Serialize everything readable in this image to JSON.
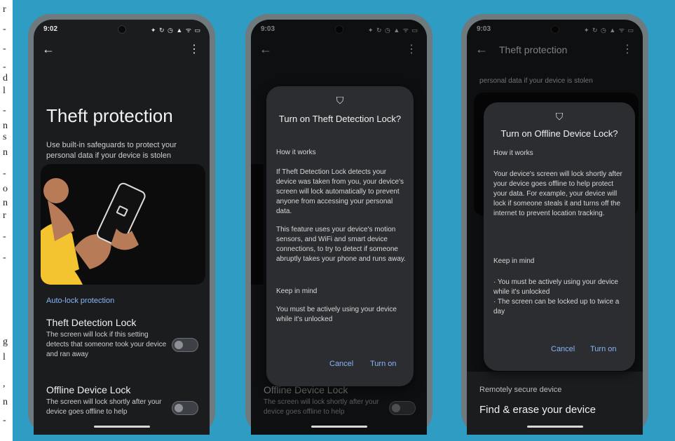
{
  "left_fragments": [
    "r",
    "-",
    "-",
    "-",
    "d",
    "l",
    "-",
    "n",
    "s",
    "n",
    "-",
    "o",
    "n",
    "r",
    "-",
    "-",
    "g",
    "l",
    ",",
    "n",
    "-"
  ],
  "phone1": {
    "time": "9:02",
    "status_icons": "✦ ↻ ◷ ▲ ᯤ ▭",
    "title": "Theft protection",
    "subtitle": "Use built-in safeguards to protect your personal data if your device is stolen",
    "section": "Auto-lock protection",
    "item1_title": "Theft Detection Lock",
    "item1_desc": "The screen will lock if this setting detects that someone took your device and ran away",
    "item2_title": "Offline Device Lock",
    "item2_desc": "The screen will lock shortly after your device goes offline to help"
  },
  "phone2": {
    "time": "9:03",
    "status_icons": "✦ ↻ ◷ ▲ ᯤ ▭",
    "dialog_title": "Turn on Theft Detection Lock?",
    "how": "How it works",
    "p1": "If Theft Detection Lock detects your device was taken from you, your device's screen will lock automatically to prevent anyone from accessing your personal data.",
    "p2": "This feature uses your device's motion sensors, and WiFi and smart device connections, to try to detect if someone abruptly takes your phone and runs away.",
    "keep": "Keep in mind",
    "p3": "You must be actively using your device while it's unlocked",
    "cancel": "Cancel",
    "turn_on": "Turn on",
    "bg_item_title": "Offline Device Lock",
    "bg_item_desc": "The screen will lock shortly after your device goes offline to help"
  },
  "phone3": {
    "time": "9:03",
    "status_icons": "✦ ↻ ◷ ▲ ᯤ ▭",
    "bar_title": "Theft protection",
    "bg_subtitle": "personal data if your device is stolen",
    "dialog_title": "Turn on Offline Device Lock?",
    "how": "How it works",
    "p1": "Your device's screen will lock shortly after your device goes offline to help protect your data. For example, your device will lock if someone steals it and turns off the internet to prevent location tracking.",
    "keep": "Keep in mind",
    "b1": "· You must be actively using your device while it's unlocked",
    "b2": "· The screen can be locked up to twice a day",
    "cancel": "Cancel",
    "turn_on": "Turn on",
    "bg_section": "Remotely secure device",
    "bg_item_title": "Find & erase your device"
  },
  "colors": {
    "background": "#2e9cc3",
    "screen": "#1a1c1e",
    "accent": "#8ab4f8",
    "dialog": "#2b2d30"
  }
}
